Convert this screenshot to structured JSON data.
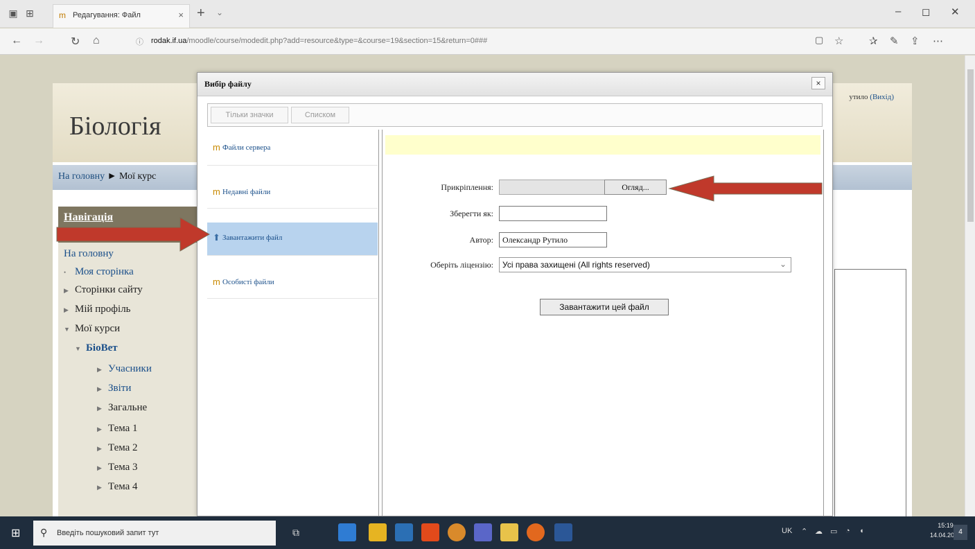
{
  "browser": {
    "tab_title": "Редагування: Файл",
    "url_host": "rodak.if.ua",
    "url_path": "/moodle/course/modedit.php?add=resource&type=&course=19&section=15&return=0###"
  },
  "site": {
    "logo": "Біологія",
    "login_user": "утило",
    "login_logout": "(Вихід)",
    "breadcrumb_home": "На головну",
    "breadcrumb_sep": " ► ",
    "breadcrumb_courses": "Мої курс"
  },
  "navigation": {
    "title": "Навігація",
    "items": [
      {
        "label": "На головну",
        "type": "home"
      },
      {
        "label": "Моя сторінка",
        "type": "leaf"
      },
      {
        "label": "Сторінки сайту",
        "type": "collapsed"
      },
      {
        "label": "Мій профіль",
        "type": "collapsed"
      },
      {
        "label": "Мої курси",
        "type": "expanded"
      },
      {
        "label": "БіоВет",
        "type": "expanded"
      },
      {
        "label": "Учасники",
        "type": "collapsed"
      },
      {
        "label": "Звіти",
        "type": "collapsed"
      },
      {
        "label": "Загальне",
        "type": "collapsed"
      },
      {
        "label": "Тема 1",
        "type": "collapsed"
      },
      {
        "label": "Тема 2",
        "type": "collapsed"
      },
      {
        "label": "Тема 3",
        "type": "collapsed"
      },
      {
        "label": "Тема 4",
        "type": "collapsed"
      }
    ]
  },
  "file_picker": {
    "title": "Вибір файлу",
    "close": "×",
    "view_icons": "Тільки значки",
    "view_list": "Списком",
    "repositories": [
      {
        "label": "Файли сервера",
        "active": false
      },
      {
        "label": "Недавні файли",
        "active": false
      },
      {
        "label": "Завантажити файл",
        "active": true
      },
      {
        "label": "Особисті файли",
        "active": false
      }
    ],
    "form": {
      "attachment_label": "Прикріплення:",
      "browse_button": "Огляд...",
      "save_as_label": "Зберегти як:",
      "save_as_value": "",
      "author_label": "Автор:",
      "author_value": "Олександр Рутило",
      "license_label": "Оберіть ліцензію:",
      "license_value": "Усі права захищені (All rights reserved)",
      "upload_button": "Завантажити цей файл"
    }
  },
  "taskbar": {
    "search_placeholder": "Введіть пошуковий запит тут",
    "lang": "UK",
    "time": "15:19",
    "date": "14.04.2020",
    "notifications": "4"
  },
  "colors": {
    "annotation_arrow": "#c0392b",
    "active_repo": "#b8d3ee"
  }
}
